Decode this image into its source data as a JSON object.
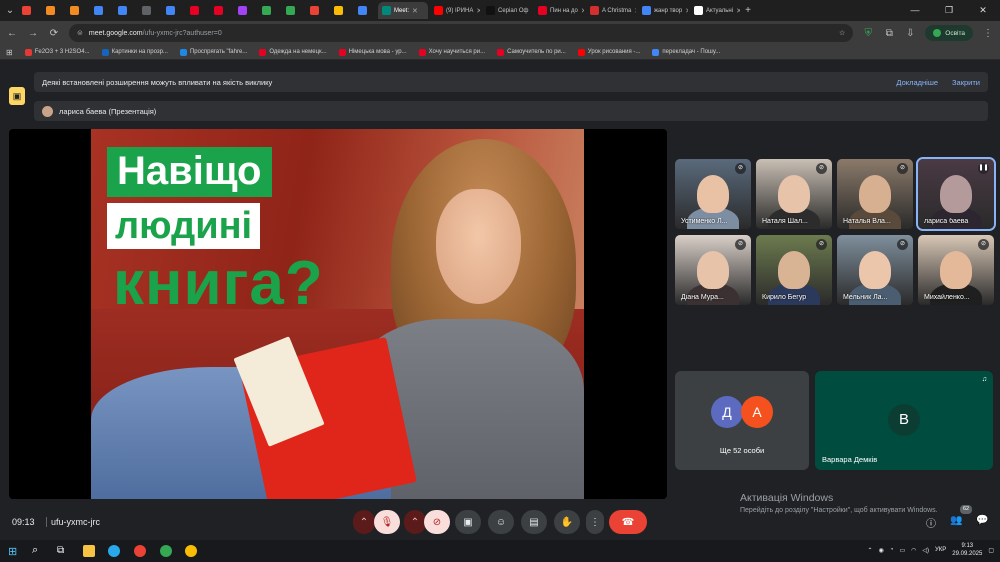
{
  "browser": {
    "tabs": [
      {
        "label": "",
        "color": "#ea4335"
      },
      {
        "label": "",
        "color": "#f28b22"
      },
      {
        "label": "",
        "color": "#f28b22"
      },
      {
        "label": "",
        "color": "#4285f4"
      },
      {
        "label": "",
        "color": "#4285f4"
      },
      {
        "label": "",
        "color": "#5f6368"
      },
      {
        "label": "",
        "color": "#4285f4"
      },
      {
        "label": "",
        "color": "#e60023"
      },
      {
        "label": "",
        "color": "#e60023"
      },
      {
        "label": "",
        "color": "#a142f4"
      },
      {
        "label": "",
        "color": "#34a853"
      },
      {
        "label": "",
        "color": "#34a853"
      },
      {
        "label": "",
        "color": "#ea4335"
      },
      {
        "label": "",
        "color": "#fbbc04"
      },
      {
        "label": "",
        "color": "#4285f4"
      },
      {
        "label": "Meet: ",
        "color": "#00897b",
        "active": true
      },
      {
        "label": "(9) ІРИНА",
        "color": "#ff0000"
      },
      {
        "label": "Серіал Oф",
        "color": "#111111"
      },
      {
        "label": "Пин на до",
        "color": "#e60023"
      },
      {
        "label": "A Christma",
        "color": "#d32f2f"
      },
      {
        "label": "жанр твор",
        "color": "#4285f4"
      },
      {
        "label": "Актуальні",
        "color": "#ffffff"
      }
    ],
    "new_tab": "+",
    "window_controls": [
      "—",
      "❐",
      "✕"
    ],
    "url_host": "meet.google.com",
    "url_path": "/ufu-yxmc-jrc?authuser=0",
    "profile_label": "Освіта",
    "bookmarks": [
      {
        "label": "Fe2O3 + 3 H2SO4...",
        "color": "#e53935"
      },
      {
        "label": "Картинки на прозр...",
        "color": "#1565c0"
      },
      {
        "label": "Проспрягать \"fahre...",
        "color": "#1e88e5"
      },
      {
        "label": "Одежда на немецк...",
        "color": "#e60023"
      },
      {
        "label": "Німецька мова - ур...",
        "color": "#e60023"
      },
      {
        "label": "Хочу научиться ри...",
        "color": "#e60023"
      },
      {
        "label": "Самоучитель по ри...",
        "color": "#e60023"
      },
      {
        "label": "Урок рисования -...",
        "color": "#ff0000"
      },
      {
        "label": "перекладач - Пошу...",
        "color": "#4285f4"
      }
    ]
  },
  "meet": {
    "extension_banner": "Деякі встановлені розширення можуть впливати на якість виклику",
    "learn_more": "Докладніше",
    "close": "Закрити",
    "presenter": "лариса баева (Презентація)",
    "slide": {
      "line1": "Навіщо",
      "line2": "людині",
      "line3": "книга?"
    },
    "participants": [
      {
        "name": "Устименко Л...",
        "bg": "#5a6a7c",
        "skin": "#e9c2a6",
        "cloth": "#7d8ea3"
      },
      {
        "name": "Наталя Шал...",
        "bg": "#c9bfb4",
        "skin": "#e6c3a9",
        "cloth": "#2c2c2c"
      },
      {
        "name": "Наталья Вла...",
        "bg": "#8b7a6a",
        "skin": "#d7b091",
        "cloth": "#5a4a3c"
      },
      {
        "name": "лариса баева",
        "bg": "#4a3a44",
        "skin": "#b59a9c",
        "cloth": "#2d2630",
        "speaking": true
      },
      {
        "name": "Діана Мура...",
        "bg": "#d9cfc8",
        "skin": "#e7c4a9",
        "cloth": "#3b3132"
      },
      {
        "name": "Кирило Бегур",
        "bg": "#6d7b4f",
        "skin": "#d9b494",
        "cloth": "#2b3a5c"
      },
      {
        "name": "Мельник Ла...",
        "bg": "#7f8f9c",
        "skin": "#ecc6ab",
        "cloth": "#4b5d70"
      },
      {
        "name": "Михайленко...",
        "bg": "#d8c7b6",
        "skin": "#e4b99a",
        "cloth": "#1f1f1f"
      }
    ],
    "more": {
      "avatars": [
        {
          "letter": "Д",
          "color": "#5c6bc0"
        },
        {
          "letter": "А",
          "color": "#f4511e"
        }
      ],
      "label": "Ще 52 особи"
    },
    "featured": {
      "letter": "В",
      "name": "Варвара Демків"
    },
    "activation_title": "Активація Windows",
    "activation_sub": "Перейдіть до розділу \"Настройки\", щоб активувати Windows.",
    "time": "09:13",
    "code": "ufu-yxmc-jrc",
    "people_count": "62"
  },
  "taskbar": {
    "lang": "УКР",
    "time": "9:13",
    "date": "29.09.2025"
  }
}
